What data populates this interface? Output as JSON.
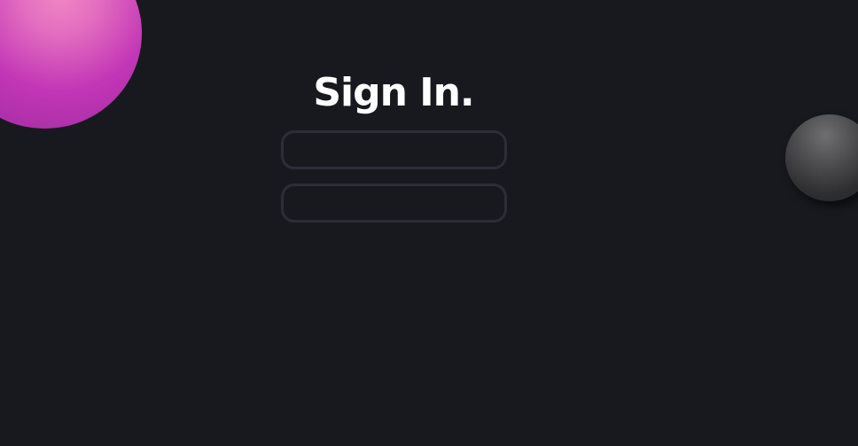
{
  "page": {
    "title": "Sign In."
  },
  "form": {
    "field_1": {
      "value": "",
      "placeholder": ""
    },
    "field_2": {
      "value": "",
      "placeholder": ""
    }
  },
  "colors": {
    "background": "#18191e",
    "field_border": "#2d2d38",
    "title_text": "#ffffff",
    "orb_pink": "#c236b6",
    "orb_dark": "#4e4e50"
  }
}
